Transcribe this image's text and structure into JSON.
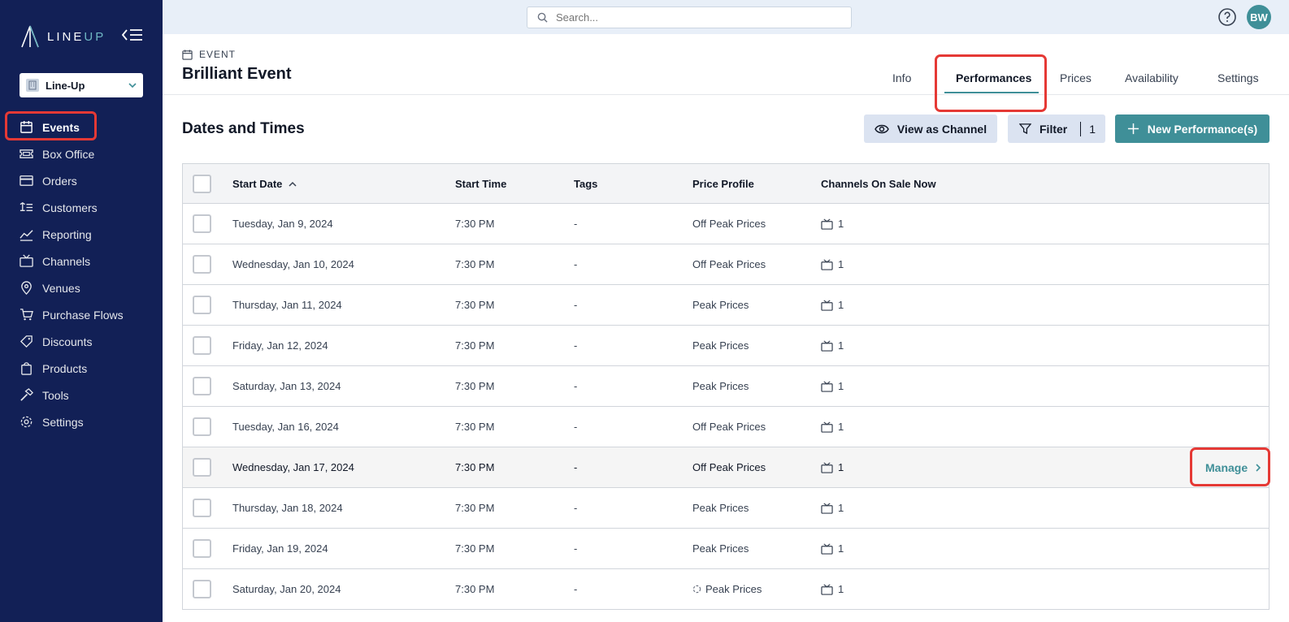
{
  "app": {
    "logo_text_main": "LINE",
    "logo_text_accent": "UP",
    "org_name": "Line-Up"
  },
  "sidebar": {
    "items": [
      {
        "label": "Events",
        "icon": "calendar-icon"
      },
      {
        "label": "Box Office",
        "icon": "ticket-icon"
      },
      {
        "label": "Orders",
        "icon": "credit-card-icon"
      },
      {
        "label": "Customers",
        "icon": "contact-card-icon"
      },
      {
        "label": "Reporting",
        "icon": "trend-line-icon"
      },
      {
        "label": "Channels",
        "icon": "tv-icon"
      },
      {
        "label": "Venues",
        "icon": "map-pin-icon"
      },
      {
        "label": "Purchase Flows",
        "icon": "shopping-cart-icon"
      },
      {
        "label": "Discounts",
        "icon": "tag-icon"
      },
      {
        "label": "Products",
        "icon": "shopping-bag-icon"
      },
      {
        "label": "Tools",
        "icon": "hammer-icon"
      },
      {
        "label": "Settings",
        "icon": "gear-icon"
      }
    ],
    "active_index": 0
  },
  "topbar": {
    "search_placeholder": "Search...",
    "avatar_initials": "BW"
  },
  "event": {
    "label": "EVENT",
    "title": "Brilliant Event"
  },
  "tabs": [
    {
      "label": "Info"
    },
    {
      "label": "Performances"
    },
    {
      "label": "Prices"
    },
    {
      "label": "Availability"
    },
    {
      "label": "Settings"
    }
  ],
  "section": {
    "title": "Dates and Times",
    "view_as_channel_label": "View as Channel",
    "filter_label": "Filter",
    "filter_count": "1",
    "new_performance_label": "New Performance(s)"
  },
  "table": {
    "columns": [
      "Start Date",
      "Start Time",
      "Tags",
      "Price Profile",
      "Channels On Sale Now"
    ],
    "manage_label": "Manage",
    "rows": [
      {
        "date": "Tuesday, Jan 9, 2024",
        "time": "7:30 PM",
        "tags": "-",
        "price_profile": "Off Peak Prices",
        "channels": "1"
      },
      {
        "date": "Wednesday, Jan 10, 2024",
        "time": "7:30 PM",
        "tags": "-",
        "price_profile": "Off Peak Prices",
        "channels": "1"
      },
      {
        "date": "Thursday, Jan 11, 2024",
        "time": "7:30 PM",
        "tags": "-",
        "price_profile": "Peak Prices",
        "channels": "1"
      },
      {
        "date": "Friday, Jan 12, 2024",
        "time": "7:30 PM",
        "tags": "-",
        "price_profile": "Peak Prices",
        "channels": "1"
      },
      {
        "date": "Saturday, Jan 13, 2024",
        "time": "7:30 PM",
        "tags": "-",
        "price_profile": "Peak Prices",
        "channels": "1"
      },
      {
        "date": "Tuesday, Jan 16, 2024",
        "time": "7:30 PM",
        "tags": "-",
        "price_profile": "Off Peak Prices",
        "channels": "1"
      },
      {
        "date": "Wednesday, Jan 17, 2024",
        "time": "7:30 PM",
        "tags": "-",
        "price_profile": "Off Peak Prices",
        "channels": "1"
      },
      {
        "date": "Thursday, Jan 18, 2024",
        "time": "7:30 PM",
        "tags": "-",
        "price_profile": "Peak Prices",
        "channels": "1"
      },
      {
        "date": "Friday, Jan 19, 2024",
        "time": "7:30 PM",
        "tags": "-",
        "price_profile": "Peak Prices",
        "channels": "1"
      },
      {
        "date": "Saturday, Jan 20, 2024",
        "time": "7:30 PM",
        "tags": "-",
        "price_profile": "Peak Prices",
        "channels": "1"
      }
    ]
  },
  "colors": {
    "sidebar_bg": "#122056",
    "accent_teal": "#3f8f98",
    "highlight_red": "#e53935",
    "topbar_bg": "#e8eff8"
  }
}
